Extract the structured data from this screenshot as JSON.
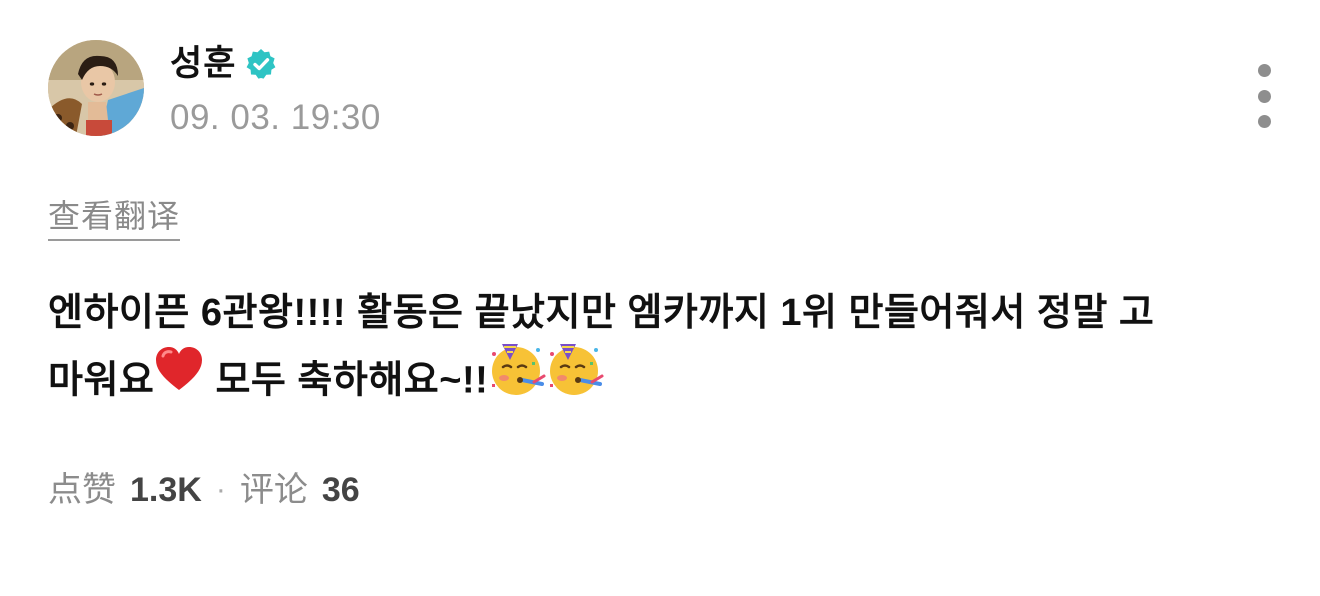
{
  "author": {
    "name": "성훈",
    "verified": true,
    "timestamp": "09. 03. 19:30",
    "avatar_icon": "user-avatar-photo"
  },
  "menu": {
    "icon": "more-vertical-icon"
  },
  "translate": {
    "label": "查看翻译"
  },
  "post": {
    "line1": "엔하이픈 6관왕!!!! 활동은 끝났지만 엠카까지 1위 만들어줘서 정말 고",
    "line2_part1": "마워요",
    "line2_part2": " 모두 축하해요~!!",
    "emojis": [
      "red-heart-icon",
      "partying-face-icon",
      "partying-face-icon"
    ]
  },
  "stats": {
    "likes_label": "点赞",
    "likes_value": "1.3K",
    "separator": "·",
    "comments_label": "评论",
    "comments_value": "36"
  },
  "colors": {
    "verified": "#2ec4c4",
    "muted": "#9a9a9a",
    "text": "#111111"
  }
}
